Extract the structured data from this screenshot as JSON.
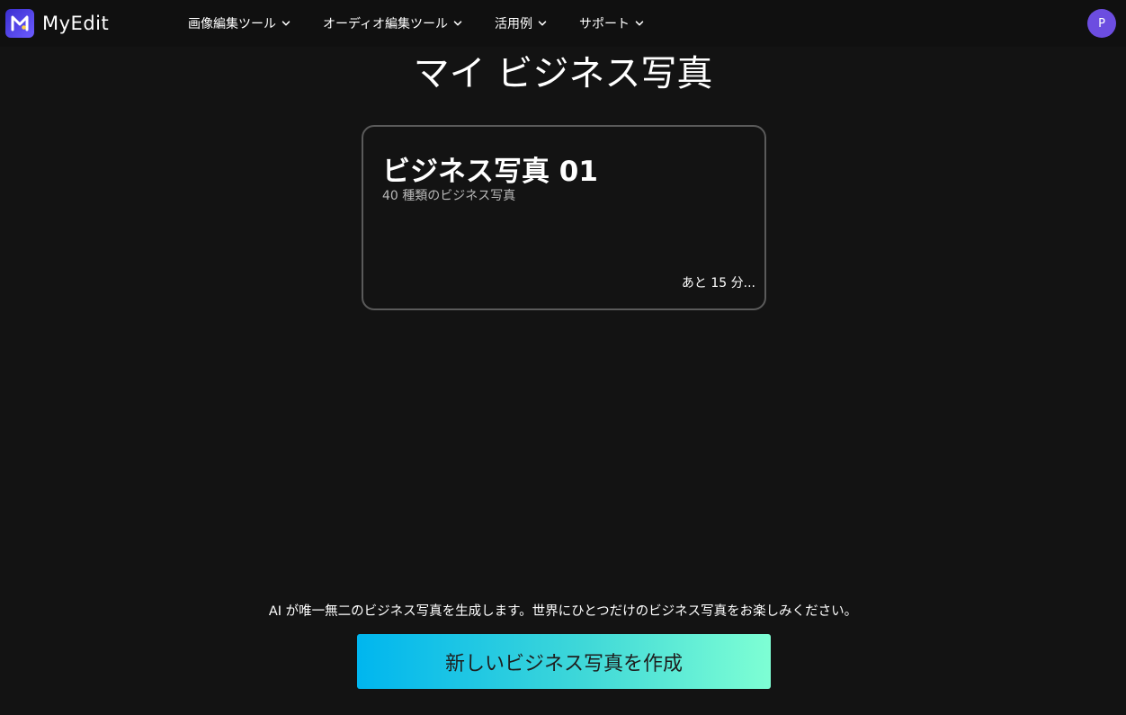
{
  "brand": {
    "name": "MyEdit",
    "icon": "myedit-logo-icon",
    "accent": "#4a3ae0"
  },
  "nav": {
    "items": [
      {
        "label": "画像編集ツール"
      },
      {
        "label": "オーディオ編集ツール"
      },
      {
        "label": "活用例"
      },
      {
        "label": "サポート"
      }
    ],
    "chevron_icon": "chevron-down-icon"
  },
  "user": {
    "avatar_initial": "P",
    "avatar_color": "#6c4de0"
  },
  "page": {
    "title": "マイ ビジネス写真"
  },
  "project_card": {
    "title": "ビジネス写真 01",
    "subtitle": "40 種類のビジネス写真",
    "status": "あと 15 分..."
  },
  "footer": {
    "tagline": "AI が唯一無二のビジネス写真を生成します。世界にひとつだけのビジネス写真をお楽しみください。",
    "create_button": "新しいビジネス写真を作成",
    "button_gradient": [
      "#00b6ef",
      "#7effd4"
    ]
  }
}
